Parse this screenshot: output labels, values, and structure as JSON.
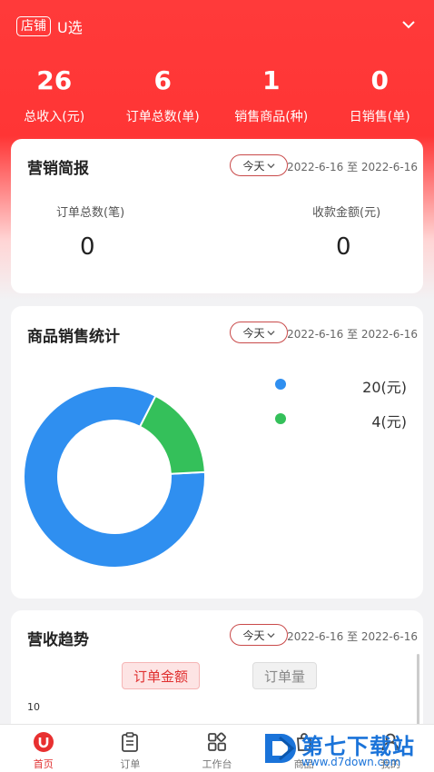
{
  "header": {
    "store_badge": "店铺",
    "store_name": "U选",
    "stats": [
      {
        "value": "26",
        "label": "总收入(元)"
      },
      {
        "value": "6",
        "label": "订单总数(单)"
      },
      {
        "value": "1",
        "label": "销售商品(种)"
      },
      {
        "value": "0",
        "label": "日销售(单)"
      }
    ]
  },
  "marketing": {
    "title": "营销简报",
    "period": "今天",
    "date_range": "2022-6-16 至 2022-6-16",
    "orders_label": "订单总数(笔)",
    "orders_value": "0",
    "amount_label": "收款金额(元)",
    "amount_value": "0"
  },
  "sales_stats": {
    "title": "商品销售统计",
    "period": "今天",
    "date_range": "2022-6-16 至 2022-6-16",
    "legend": [
      {
        "label": "20(元)",
        "color": "#2f8ff0"
      },
      {
        "label": "4(元)",
        "color": "#34c05a"
      }
    ]
  },
  "chart_data": {
    "type": "pie",
    "donut": true,
    "values": [
      20,
      4
    ],
    "labels": [
      "20(元)",
      "4(元)"
    ],
    "colors": [
      "#2f8ff0",
      "#34c05a"
    ],
    "legend_position": "right"
  },
  "revenue_trend": {
    "title": "营收趋势",
    "period": "今天",
    "date_range": "2022-6-16 至 2022-6-16",
    "toggle_active": "订单金额",
    "toggle_inactive": "订单量",
    "axis_tick": "10"
  },
  "tabbar": {
    "home": "首页",
    "orders": "订单",
    "workbench": "工作台",
    "goods": "商品",
    "mine": "我的"
  },
  "watermark": {
    "text": "第七下载站",
    "url": "www.d7down.com"
  }
}
